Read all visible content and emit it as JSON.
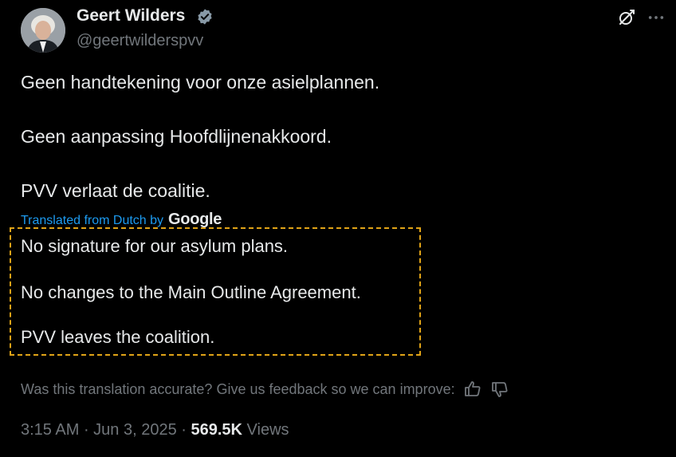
{
  "author": {
    "name": "Geert Wilders",
    "handle": "@geertwilderspvv",
    "verified_icon": "verified-badge-icon"
  },
  "tweet": {
    "lines": [
      "Geen handtekening voor onze asielplannen.",
      "Geen aanpassing Hoofdlijnenakkoord.",
      "PVV verlaat de coalitie."
    ],
    "translated_label": "Translated from Dutch by",
    "translator": "Google",
    "translation": [
      "No signature for our asylum plans.",
      "No changes to the Main Outline Agreement.",
      "PVV leaves the coalition."
    ],
    "feedback": "Was this translation accurate? Give us feedback so we can improve:",
    "time": "3:15 AM",
    "date": "Jun 3, 2025",
    "views_count": "569.5K",
    "views_label": "Views"
  },
  "icons": {
    "grok": "grok-icon",
    "more": "more-icon",
    "thumbs_up": "thumbs-up-icon",
    "thumbs_down": "thumbs-down-icon"
  },
  "colors": {
    "background": "#000000",
    "text": "#e7e9ea",
    "muted": "#71767b",
    "link": "#1d9bf0",
    "highlight_border": "#e0a317"
  }
}
